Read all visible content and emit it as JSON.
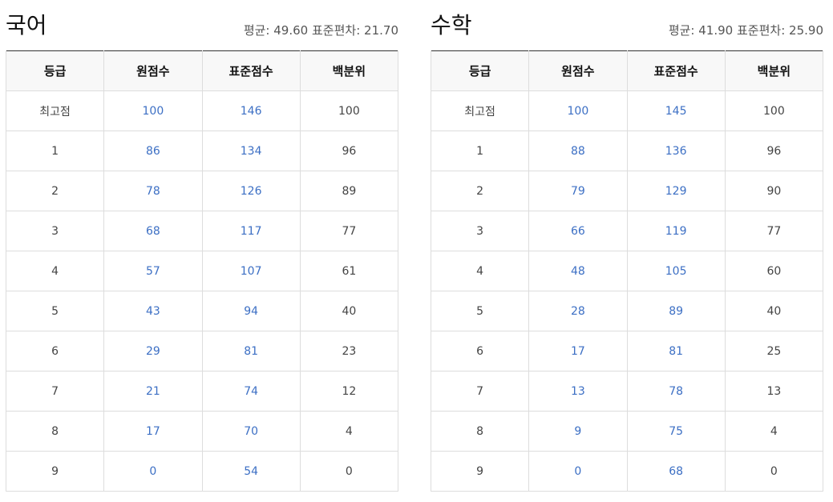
{
  "columns": [
    "등급",
    "원점수",
    "표준점수",
    "백분위"
  ],
  "stats_labels": {
    "mean": "평균:",
    "std": "표준편차:"
  },
  "panels": [
    {
      "title": "국어",
      "mean": "49.60",
      "std": "21.70",
      "rows": [
        [
          "최고점",
          "100",
          "146",
          "100"
        ],
        [
          "1",
          "86",
          "134",
          "96"
        ],
        [
          "2",
          "78",
          "126",
          "89"
        ],
        [
          "3",
          "68",
          "117",
          "77"
        ],
        [
          "4",
          "57",
          "107",
          "61"
        ],
        [
          "5",
          "43",
          "94",
          "40"
        ],
        [
          "6",
          "29",
          "81",
          "23"
        ],
        [
          "7",
          "21",
          "74",
          "12"
        ],
        [
          "8",
          "17",
          "70",
          "4"
        ],
        [
          "9",
          "0",
          "54",
          "0"
        ]
      ]
    },
    {
      "title": "수학",
      "mean": "41.90",
      "std": "25.90",
      "rows": [
        [
          "최고점",
          "100",
          "145",
          "100"
        ],
        [
          "1",
          "88",
          "136",
          "96"
        ],
        [
          "2",
          "79",
          "129",
          "90"
        ],
        [
          "3",
          "66",
          "119",
          "77"
        ],
        [
          "4",
          "48",
          "105",
          "60"
        ],
        [
          "5",
          "28",
          "89",
          "40"
        ],
        [
          "6",
          "17",
          "81",
          "25"
        ],
        [
          "7",
          "13",
          "78",
          "13"
        ],
        [
          "8",
          "9",
          "75",
          "4"
        ],
        [
          "9",
          "0",
          "68",
          "0"
        ]
      ]
    }
  ],
  "colors": {
    "link_blue": "#3c6fc4",
    "header_bg": "#f8f8f8",
    "border": "#dddddd"
  }
}
